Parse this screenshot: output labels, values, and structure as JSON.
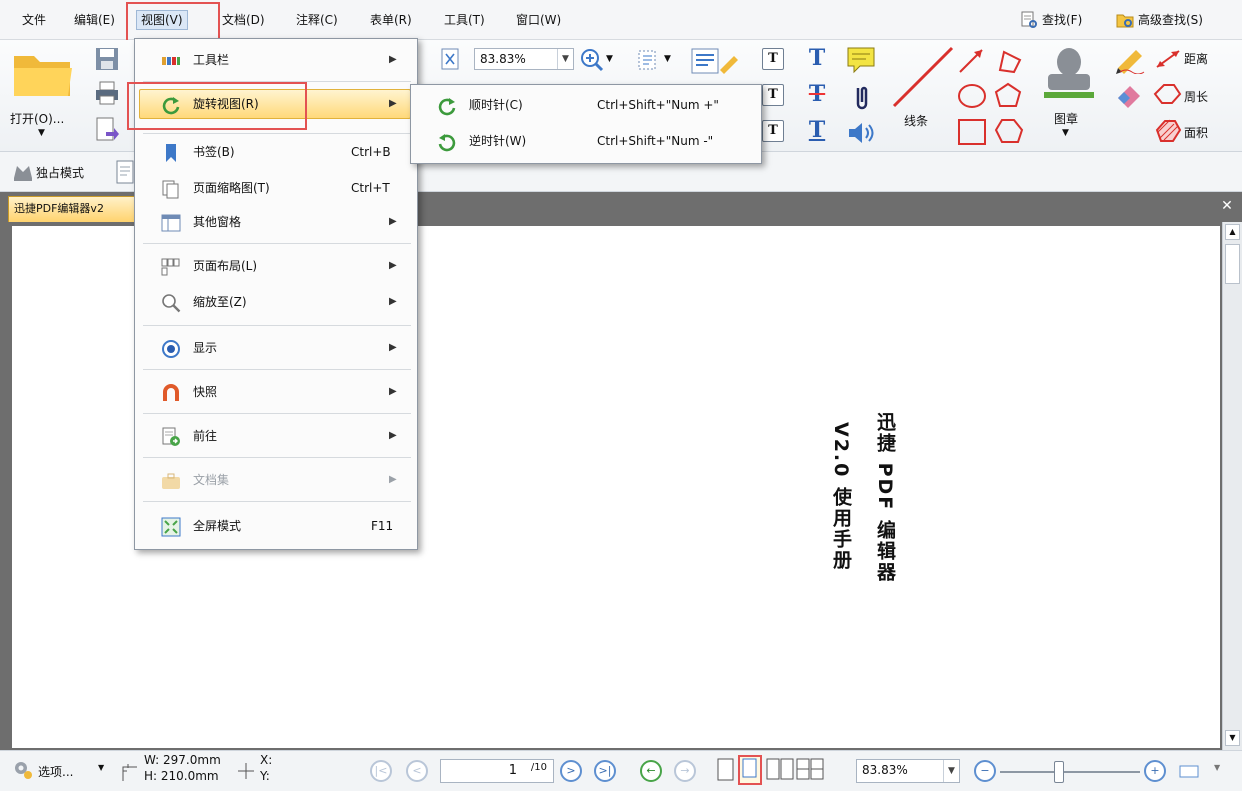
{
  "menubar": {
    "items": [
      "文件",
      "编辑(E)",
      "视图(V)",
      "文档(D)",
      "注释(C)",
      "表单(R)",
      "工具(T)",
      "窗口(W)"
    ],
    "find_label": "查找(F)",
    "advanced_find_label": "高级查找(S)"
  },
  "ribbon": {
    "open_label": "打开(O)...",
    "zoom_value": "83.83%",
    "line_label": "线条",
    "stamp_label": "图章",
    "distance_label": "距离",
    "perimeter_label": "周长",
    "area_label": "面积"
  },
  "toolbar2": {
    "exclusive_mode_label": "独占模式"
  },
  "tab": {
    "title": "迅捷PDF编辑器v2"
  },
  "view_menu": {
    "items": [
      {
        "label": "工具栏",
        "shortcut": "",
        "has_submenu": true
      },
      {
        "label": "旋转视图(R)",
        "shortcut": "",
        "has_submenu": true
      },
      {
        "label": "书签(B)",
        "shortcut": "Ctrl+B",
        "has_submenu": false
      },
      {
        "label": "页面缩略图(T)",
        "shortcut": "Ctrl+T",
        "has_submenu": false
      },
      {
        "label": "其他窗格",
        "shortcut": "",
        "has_submenu": true
      },
      {
        "label": "页面布局(L)",
        "shortcut": "",
        "has_submenu": true
      },
      {
        "label": "缩放至(Z)",
        "shortcut": "",
        "has_submenu": true
      },
      {
        "label": "显示",
        "shortcut": "",
        "has_submenu": true
      },
      {
        "label": "快照",
        "shortcut": "",
        "has_submenu": true
      },
      {
        "label": "前往",
        "shortcut": "",
        "has_submenu": true
      },
      {
        "label": "文档集",
        "shortcut": "",
        "has_submenu": true
      },
      {
        "label": "全屏模式",
        "shortcut": "F11",
        "has_submenu": false
      }
    ],
    "highlighted_index": 1
  },
  "rotate_submenu": {
    "items": [
      {
        "label": "顺时针(C)",
        "shortcut": "Ctrl+Shift+\"Num +\""
      },
      {
        "label": "逆时针(W)",
        "shortcut": "Ctrl+Shift+\"Num -\""
      }
    ]
  },
  "document": {
    "title_line": "迅捷 PDF 编辑器",
    "subtitle_line": "V2.0 使用手册"
  },
  "statusbar": {
    "options_label": "选项...",
    "width_text": "W: 297.0mm",
    "height_text": "H: 210.0mm",
    "x_text": "X:",
    "y_text": "Y:",
    "page_current": "1",
    "page_total": "/10",
    "zoom_value": "83.83%"
  },
  "colors": {
    "highlight_box": "#e35252",
    "menu_highlight": "#ffd97a",
    "doc_tab": "#ffd36e",
    "nav_blue": "#5e8fd0"
  }
}
